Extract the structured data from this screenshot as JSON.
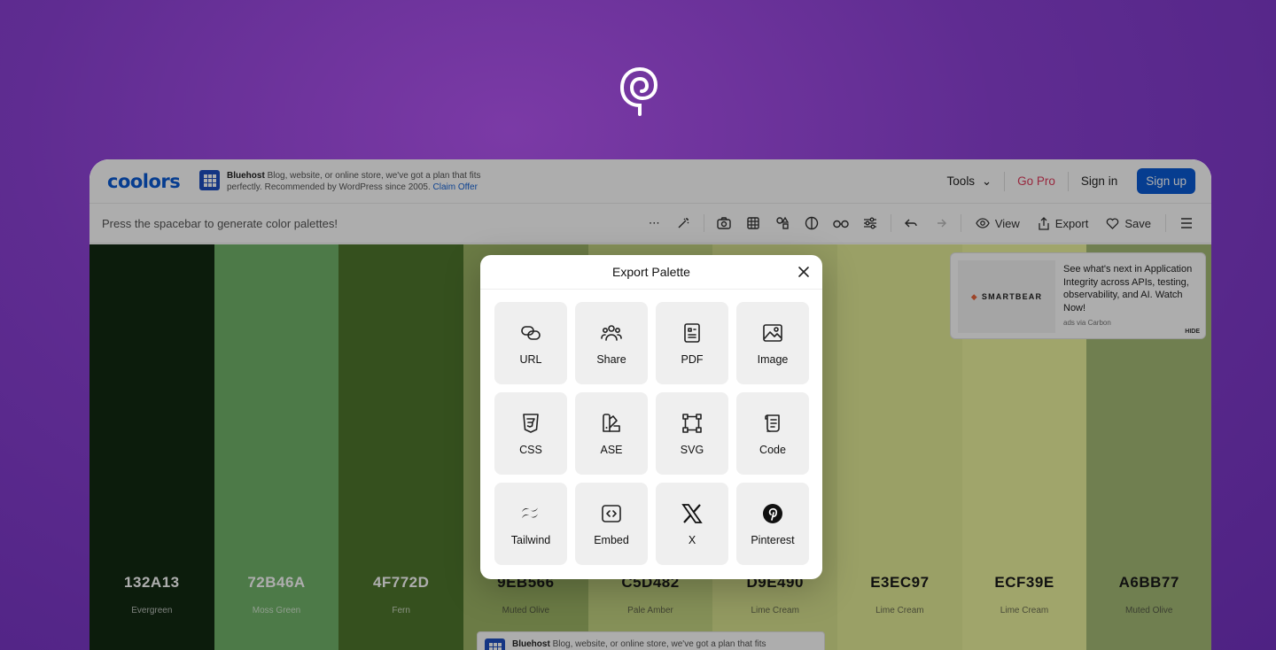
{
  "brand": "coolors",
  "top_ad": {
    "sponsor": "Bluehost",
    "text": "Blog, website, or online store, we've got a plan that fits perfectly. Recommended by WordPress since 2005.",
    "cta": "Claim Offer"
  },
  "nav": {
    "tools": "Tools",
    "go_pro": "Go Pro",
    "sign_in": "Sign in",
    "sign_up": "Sign up"
  },
  "toolbar": {
    "hint": "Press the spacebar to generate color palettes!",
    "view": "View",
    "export": "Export",
    "save": "Save"
  },
  "palette": [
    {
      "hex": "132A13",
      "name": "Evergreen",
      "color": "#132a13",
      "tone": "dark"
    },
    {
      "hex": "72B46A",
      "name": "Moss Green",
      "color": "#72b46a",
      "tone": "dark"
    },
    {
      "hex": "4F772D",
      "name": "Fern",
      "color": "#4f772d",
      "tone": "dark"
    },
    {
      "hex": "9EB566",
      "name": "Muted Olive",
      "color": "#9eb566",
      "tone": "light"
    },
    {
      "hex": "C5D482",
      "name": "Pale Amber",
      "color": "#c5d482",
      "tone": "light"
    },
    {
      "hex": "D9E490",
      "name": "Lime Cream",
      "color": "#d9e490",
      "tone": "light"
    },
    {
      "hex": "E3EC97",
      "name": "Lime Cream",
      "color": "#e3ec97",
      "tone": "light"
    },
    {
      "hex": "ECF39E",
      "name": "Lime Cream",
      "color": "#ecf39e",
      "tone": "light"
    },
    {
      "hex": "A6BB77",
      "name": "Muted Olive",
      "color": "#a6bb77",
      "tone": "light"
    }
  ],
  "side_ad": {
    "logo_text": "SMARTBEAR",
    "text": "See what's next in Application Integrity across APIs, testing, observability, and AI. Watch Now!",
    "via": "ads via Carbon",
    "hide": "HIDE"
  },
  "bottom_ad": {
    "sponsor": "Bluehost",
    "text": "Blog, website, or online store, we've got a plan that fits"
  },
  "modal": {
    "title": "Export Palette",
    "options": [
      {
        "label": "URL",
        "icon": "link-icon"
      },
      {
        "label": "Share",
        "icon": "users-icon"
      },
      {
        "label": "PDF",
        "icon": "document-icon"
      },
      {
        "label": "Image",
        "icon": "image-icon"
      },
      {
        "label": "CSS",
        "icon": "css-icon"
      },
      {
        "label": "ASE",
        "icon": "swatches-icon"
      },
      {
        "label": "SVG",
        "icon": "vector-icon"
      },
      {
        "label": "Code",
        "icon": "scroll-icon"
      },
      {
        "label": "Tailwind",
        "icon": "tailwind-icon"
      },
      {
        "label": "Embed",
        "icon": "embed-icon"
      },
      {
        "label": "X",
        "icon": "x-logo-icon"
      },
      {
        "label": "Pinterest",
        "icon": "pinterest-icon"
      }
    ]
  }
}
